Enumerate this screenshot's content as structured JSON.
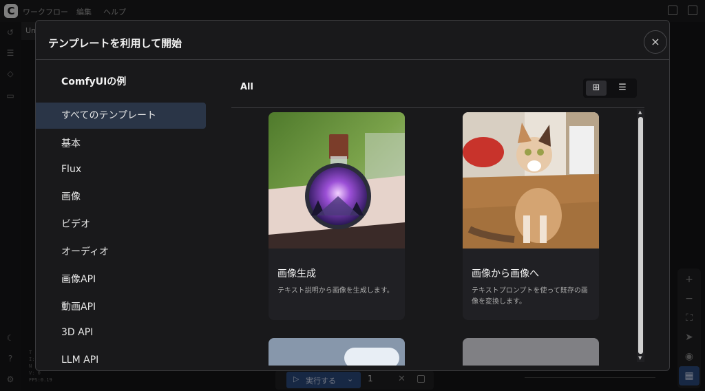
{
  "app": {
    "logo_letter": "C",
    "menu": [
      "ワークフロー",
      "編集",
      "ヘルプ"
    ],
    "tab_stub": "Un",
    "fps": "FPS:0.19",
    "status_lines": [
      "T",
      "I:",
      "N",
      "V: 0"
    ],
    "run_label": "実行する",
    "run_count": "1"
  },
  "modal": {
    "title": "テンプレートを利用して開始",
    "close_label": "×",
    "nav_heading": "ComfyUIの例",
    "nav_items": [
      "すべてのテンプレート",
      "基本",
      "Flux",
      "画像",
      "ビデオ",
      "オーディオ",
      "画像API",
      "動画API",
      "3D API",
      "LLM API"
    ],
    "content_title": "All",
    "cards": [
      {
        "title": "画像生成",
        "desc": "テキスト説明から画像を生成します。"
      },
      {
        "title": "画像から画像へ",
        "desc": "テキストプロンプトを使って既存の画像を変換します。"
      }
    ]
  },
  "colors": {
    "accent": "#2b4a7d",
    "active_nav": "#2a3547",
    "modal_bg": "#19191b"
  },
  "icons": {
    "grid_view": "grid-icon",
    "list_view": "list-icon",
    "close": "close-icon"
  }
}
